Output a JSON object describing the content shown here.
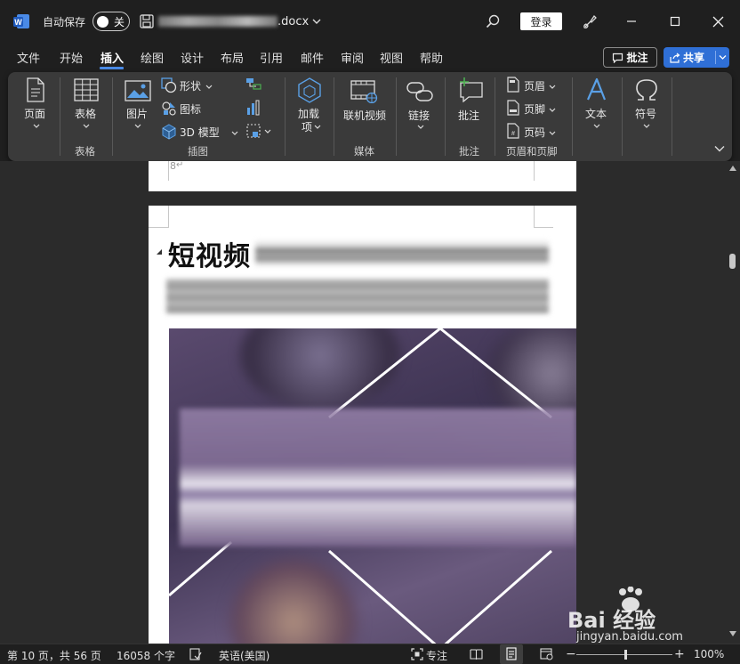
{
  "titlebar": {
    "autosave_label": "自动保存",
    "autosave_toggle": "关",
    "filename": ".docx",
    "login_label": "登录"
  },
  "menu": [
    "文件",
    "开始",
    "插入",
    "绘图",
    "设计",
    "布局",
    "引用",
    "邮件",
    "审阅",
    "视图",
    "帮助"
  ],
  "menu_active": "插入",
  "comments_button": "批注",
  "share_button": "共享",
  "ribbon": {
    "page": "页面",
    "table": "表格",
    "picture": "图片",
    "shapes": "形状",
    "icons": "图标",
    "model3d": "3D 模型",
    "addin_line1": "加载",
    "addin_line2": "项",
    "online_video": "联机视频",
    "link": "链接",
    "comment": "批注",
    "header": "页眉",
    "footer": "页脚",
    "page_number": "页码",
    "text": "文本",
    "symbol": "符号",
    "groups": {
      "tables": "表格",
      "illustrations": "插图",
      "media": "媒体",
      "comments": "批注",
      "header_footer": "页眉和页脚"
    }
  },
  "document": {
    "heading": "短视频",
    "page_marker": "8"
  },
  "status": {
    "page_info": "第 10 页，共 56 页",
    "word_count": "16058 个字",
    "language": "英语(美国)",
    "focus": "专注",
    "zoom": "100%"
  },
  "watermark": {
    "brand": "Bai  经验",
    "url": "jingyan.baidu.com"
  },
  "colors": {
    "accent": "#2f6fd6",
    "ribbon_bg": "#3a3a3a",
    "window_bg": "#1f1f1f",
    "icon_blue": "#5aa0e6"
  }
}
